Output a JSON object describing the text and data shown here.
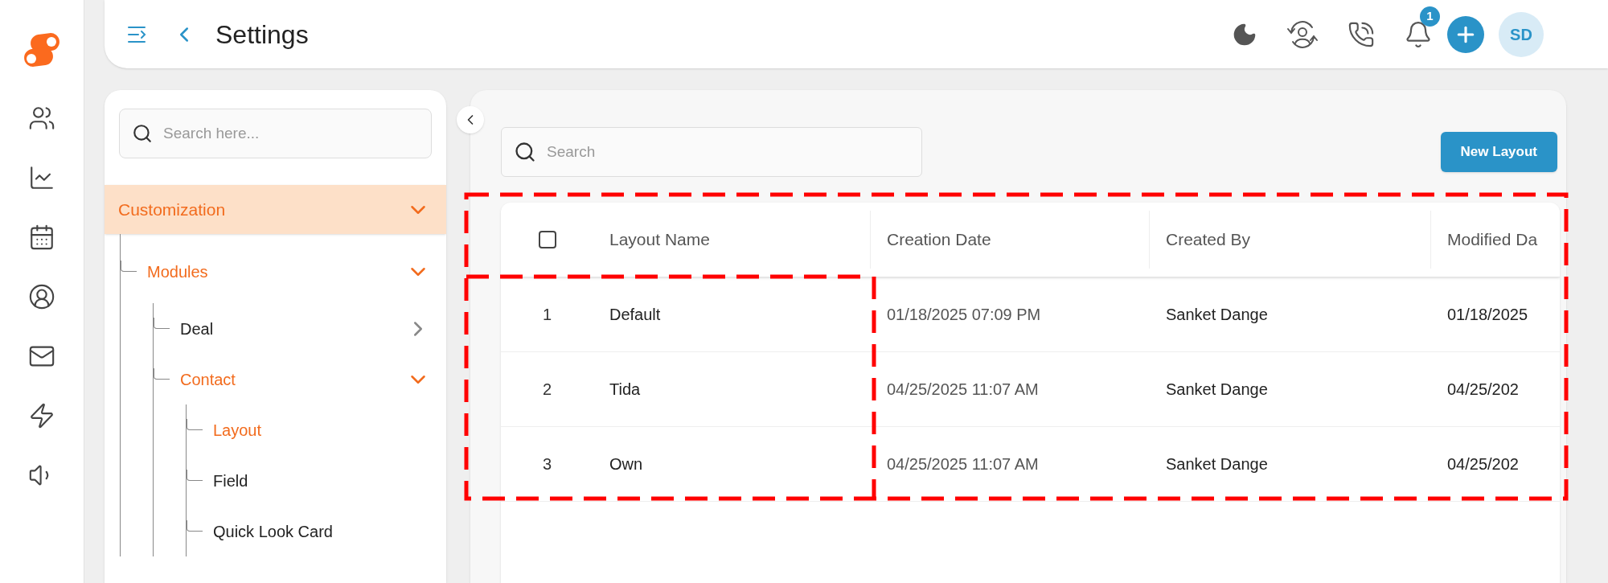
{
  "header": {
    "title": "Settings",
    "notification_count": "1",
    "avatar_initials": "SD"
  },
  "sidebar": {
    "search": {
      "placeholder": "Search here..."
    },
    "tree": [
      {
        "label": "Customization",
        "kind": "folder",
        "expanded": true,
        "children": [
          {
            "label": "Modules",
            "kind": "folder",
            "expanded": true,
            "children": [
              {
                "label": "Deal",
                "kind": "folder",
                "expanded": false
              },
              {
                "label": "Contact",
                "kind": "folder",
                "expanded": true,
                "children": [
                  {
                    "label": "Layout",
                    "kind": "page",
                    "selected": true
                  },
                  {
                    "label": "Field",
                    "kind": "page",
                    "selected": false
                  },
                  {
                    "label": "Quick Look Card",
                    "kind": "page",
                    "selected": false
                  }
                ]
              }
            ]
          }
        ]
      }
    ]
  },
  "main": {
    "search": {
      "placeholder": "Search"
    },
    "new_button": "New Layout",
    "table": {
      "select_all": {
        "checked": false
      },
      "columns": [
        "Layout Name",
        "Creation Date",
        "Created By",
        "Modified Da"
      ],
      "rows": [
        {
          "number": "1",
          "cells": [
            "Default",
            "01/18/2025 07:09 PM",
            "Sanket Dange",
            "01/18/2025"
          ]
        },
        {
          "number": "2",
          "cells": [
            "Tida",
            "04/25/2025 11:07 AM",
            "Sanket Dange",
            "04/25/202"
          ]
        },
        {
          "number": "3",
          "cells": [
            "Own",
            "04/25/2025 11:07 AM",
            "Sanket Dange",
            "04/25/202"
          ]
        }
      ]
    }
  }
}
